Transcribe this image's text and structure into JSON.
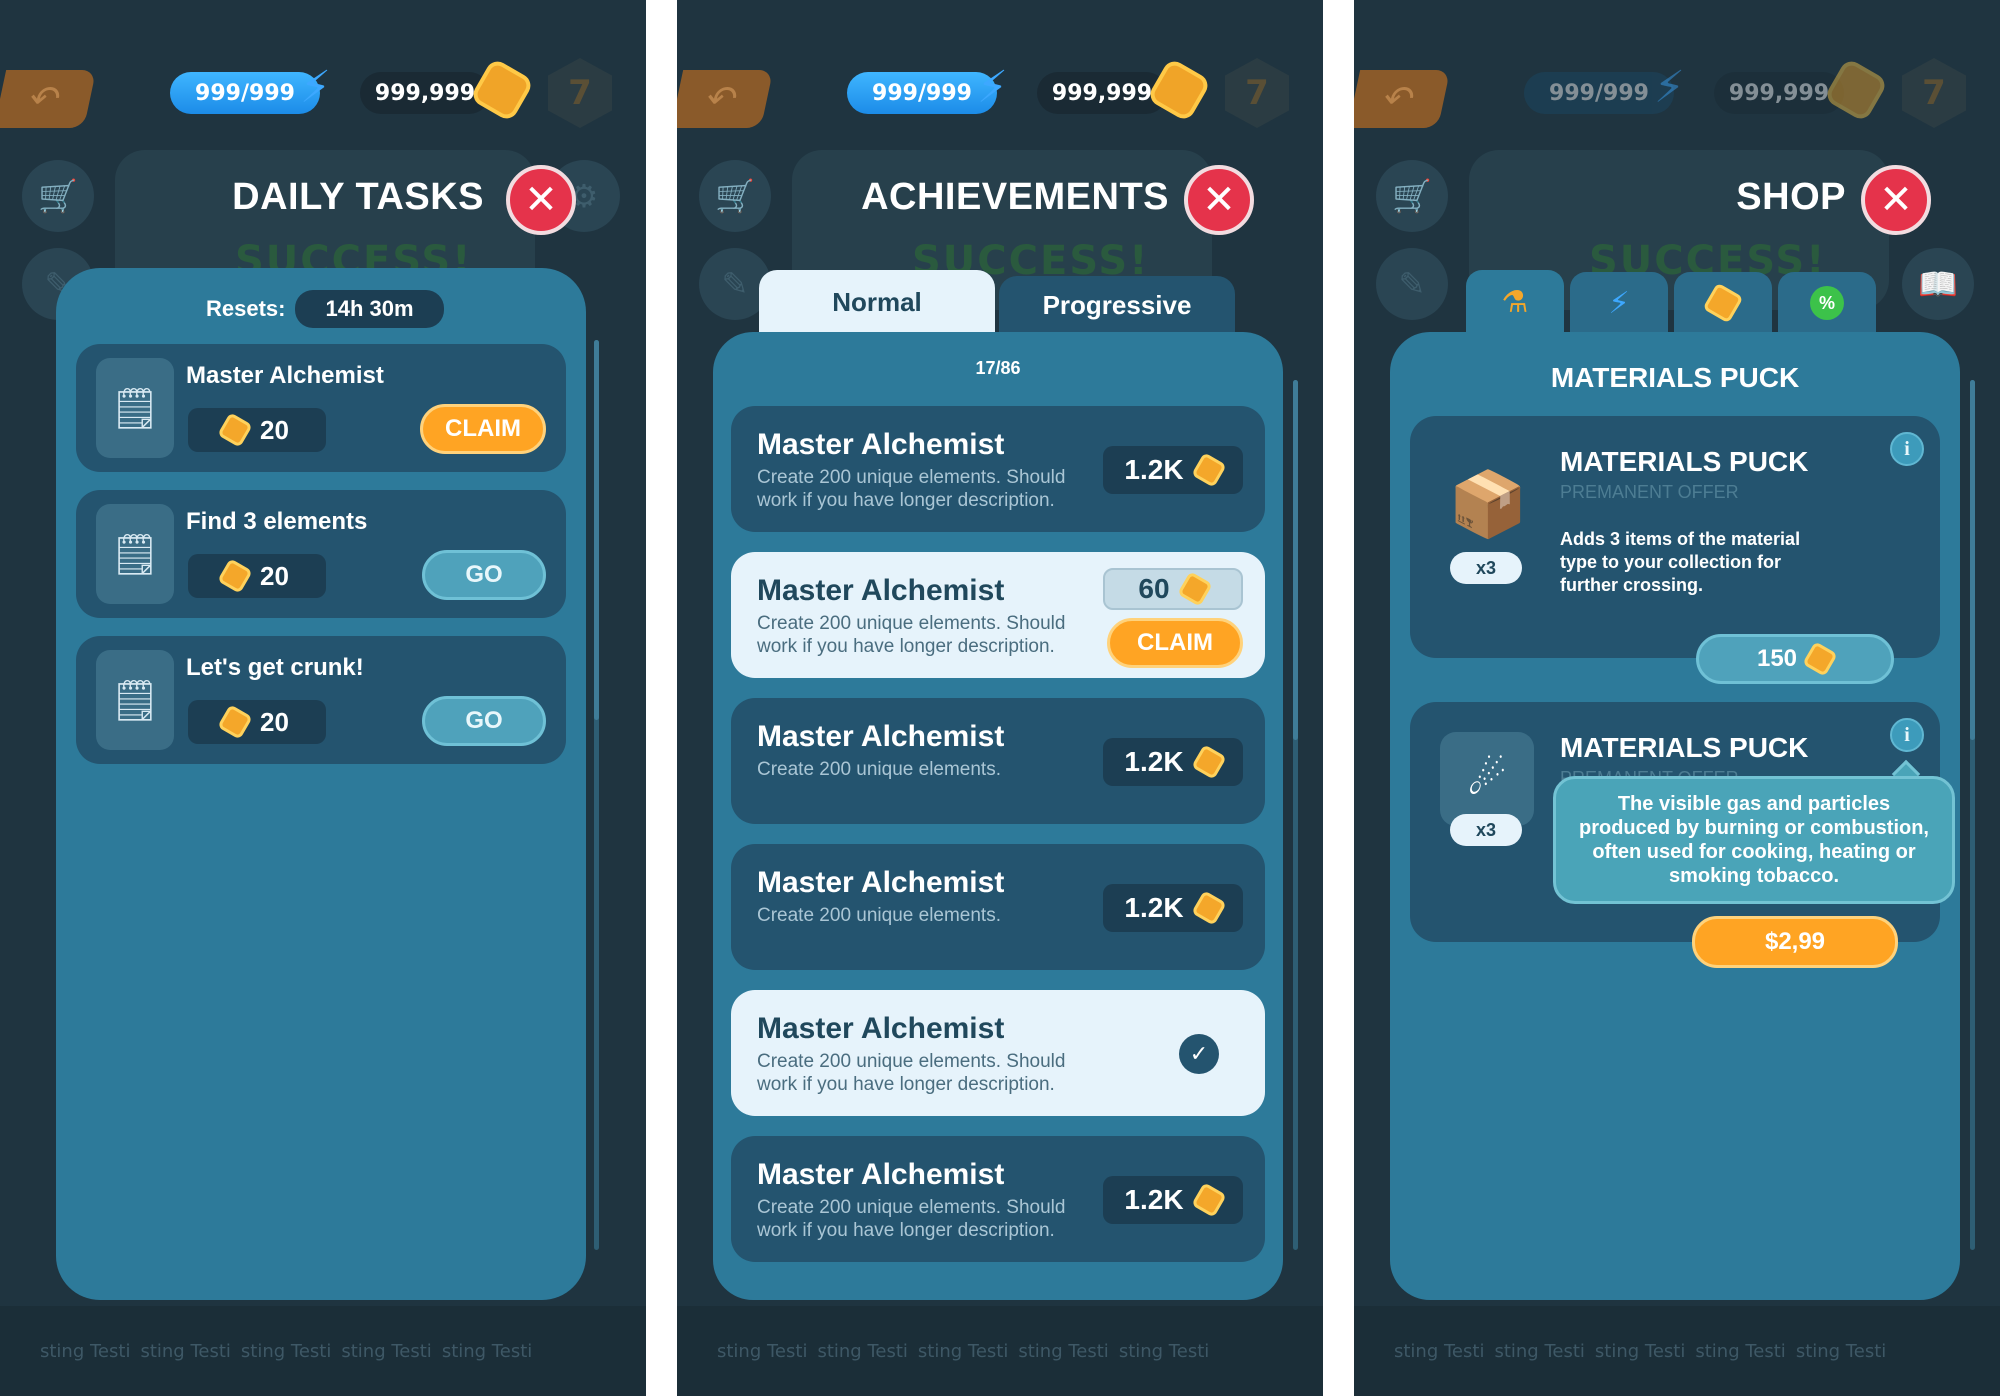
{
  "hud": {
    "energy": "999/999",
    "coins": "999,999",
    "level": "7"
  },
  "background": {
    "success": "SUCCESS!",
    "bottom_text": [
      "sting Testi",
      "sting Testi",
      "sting Testi",
      "sting Testi",
      "sting Testi"
    ]
  },
  "daily": {
    "title": "DAILY TASKS",
    "resets_label": "Resets:",
    "resets_time": "14h 30m",
    "tasks": [
      {
        "title": "Master Alchemist",
        "reward": "20",
        "action": "CLAIM"
      },
      {
        "title": "Find 3 elements",
        "reward": "20",
        "action": "GO"
      },
      {
        "title": "Let's get crunk!",
        "reward": "20",
        "action": "GO"
      }
    ]
  },
  "achievements": {
    "title": "ACHIEVEMENTS",
    "tabs": [
      "Normal",
      "Progressive"
    ],
    "active_tab": "Normal",
    "count": "17/86",
    "items": [
      {
        "title": "Master Alchemist",
        "desc": "Create 200 unique elements. Should work if you have longer description.",
        "value": "1.2K",
        "state": "locked"
      },
      {
        "title": "Master Alchemist",
        "desc": "Create 200 unique elements. Should work if you have longer description.",
        "value": "60",
        "state": "claimable",
        "action": "CLAIM"
      },
      {
        "title": "Master Alchemist",
        "desc": "Create 200 unique elements.",
        "value": "1.2K",
        "state": "locked"
      },
      {
        "title": "Master Alchemist",
        "desc": "Create 200 unique elements.",
        "value": "1.2K",
        "state": "locked"
      },
      {
        "title": "Master Alchemist",
        "desc": "Create 200 unique elements. Should work if you have longer description.",
        "state": "completed"
      },
      {
        "title": "Master Alchemist",
        "desc": "Create 200 unique elements. Should work if you have longer description.",
        "value": "1.2K",
        "state": "locked"
      }
    ]
  },
  "shop": {
    "title": "SHOP",
    "tab_icons": [
      "potion-icon",
      "bolt-icon",
      "coin-icon",
      "percent-icon"
    ],
    "section_title": "MATERIALS PUCK",
    "items": [
      {
        "name": "MATERIALS PUCK",
        "subtitle": "PREMANENT OFFER",
        "desc": "Adds 3 items of the material type to your collection for further crossing.",
        "qty": "x3",
        "price": "150"
      },
      {
        "name": "MATERIALS PUCK",
        "subtitle": "PREMANENT OFFER",
        "qty": "x3",
        "price": "$2,99"
      }
    ],
    "tooltip": "The visible gas and particles produced by burning or combustion, often used for cooking, heating or smoking tobacco."
  },
  "colors": {
    "panel": "#2d7a9a",
    "card": "#24546f",
    "claim": "#ffa423",
    "close": "#e5334b",
    "energy": "#1c8ce8"
  }
}
